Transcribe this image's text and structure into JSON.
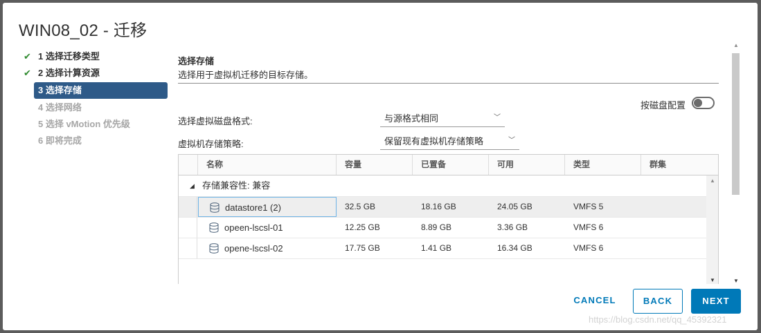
{
  "dialog": {
    "title": "WIN08_02 - 迁移"
  },
  "steps": [
    {
      "label": "1 选择迁移类型",
      "state": "completed",
      "icon": "check-icon"
    },
    {
      "label": "2 选择计算资源",
      "state": "completed",
      "icon": "check-icon"
    },
    {
      "label": "3 选择存储",
      "state": "active"
    },
    {
      "label": "4 选择网络",
      "state": "disabled"
    },
    {
      "label": "5 选择 vMotion 优先级",
      "state": "disabled"
    },
    {
      "label": "6 即将完成",
      "state": "disabled"
    }
  ],
  "section": {
    "title": "选择存储",
    "description": "选择用于虚拟机迁移的目标存储。"
  },
  "per_disk": {
    "label": "按磁盘配置",
    "enabled": false
  },
  "form": {
    "disk_format_label": "选择虚拟磁盘格式:",
    "disk_format_value": "与源格式相同",
    "storage_policy_label": "虚拟机存储策略:",
    "storage_policy_value": "保留现有虚拟机存储策略"
  },
  "table": {
    "columns": [
      "名称",
      "容量",
      "已置备",
      "可用",
      "类型",
      "群集"
    ],
    "group_label": "存储兼容性: 兼容",
    "rows": [
      {
        "name": "datastore1 (2)",
        "capacity": "32.5 GB",
        "provisioned": "18.16 GB",
        "free": "24.05 GB",
        "type": "VMFS 5",
        "cluster": "",
        "selected": true
      },
      {
        "name": "opeen-lscsl-01",
        "capacity": "12.25 GB",
        "provisioned": "8.89 GB",
        "free": "3.36 GB",
        "type": "VMFS 6",
        "cluster": "",
        "selected": false
      },
      {
        "name": "opene-lscsl-02",
        "capacity": "17.75 GB",
        "provisioned": "1.41 GB",
        "free": "16.34 GB",
        "type": "VMFS 6",
        "cluster": "",
        "selected": false
      }
    ]
  },
  "buttons": {
    "cancel": "CANCEL",
    "back": "BACK",
    "next": "NEXT"
  },
  "watermark": "https://blog.csdn.net/qq_45392321",
  "colors": {
    "accent": "#0079b8",
    "active_step": "#2e5a88",
    "check": "#2f8a2f"
  }
}
